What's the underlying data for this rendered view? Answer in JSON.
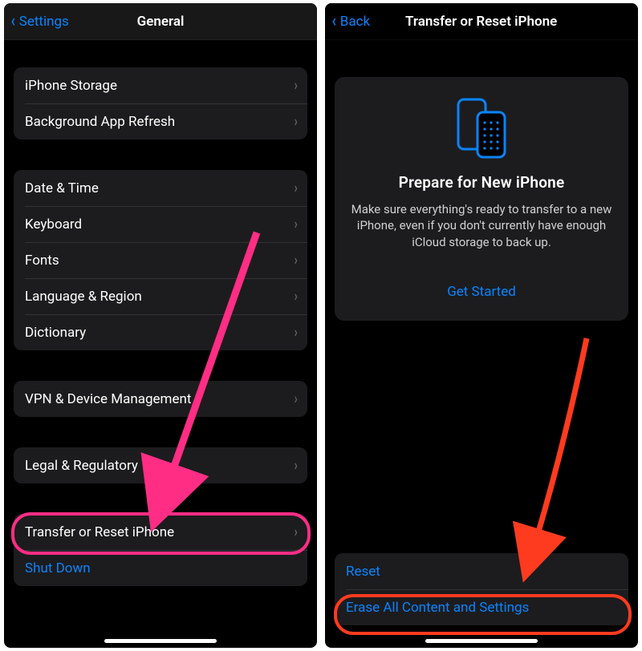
{
  "colors": {
    "ios_blue": "#0a84ff",
    "annotation_pink": "#ff2d84",
    "annotation_red": "#ff3b1f"
  },
  "left": {
    "nav": {
      "back_label": "Settings",
      "title": "General"
    },
    "group1": [
      {
        "label": "iPhone Storage"
      },
      {
        "label": "Background App Refresh"
      }
    ],
    "group2": [
      {
        "label": "Date & Time"
      },
      {
        "label": "Keyboard"
      },
      {
        "label": "Fonts"
      },
      {
        "label": "Language & Region"
      },
      {
        "label": "Dictionary"
      }
    ],
    "group3": [
      {
        "label": "VPN & Device Management"
      }
    ],
    "group4": [
      {
        "label": "Legal & Regulatory"
      }
    ],
    "group5": [
      {
        "label": "Transfer or Reset iPhone"
      },
      {
        "label": "Shut Down",
        "link": true
      }
    ]
  },
  "right": {
    "nav": {
      "back_label": "Back",
      "title": "Transfer or Reset iPhone"
    },
    "hero": {
      "icon": "two-iphones-icon",
      "title": "Prepare for New iPhone",
      "body": "Make sure everything's ready to transfer to a new iPhone, even if you don't currently have enough iCloud storage to back up.",
      "cta": "Get Started"
    },
    "bottom_group": [
      {
        "label": "Reset",
        "link": true
      },
      {
        "label": "Erase All Content and Settings",
        "link": true
      }
    ]
  }
}
